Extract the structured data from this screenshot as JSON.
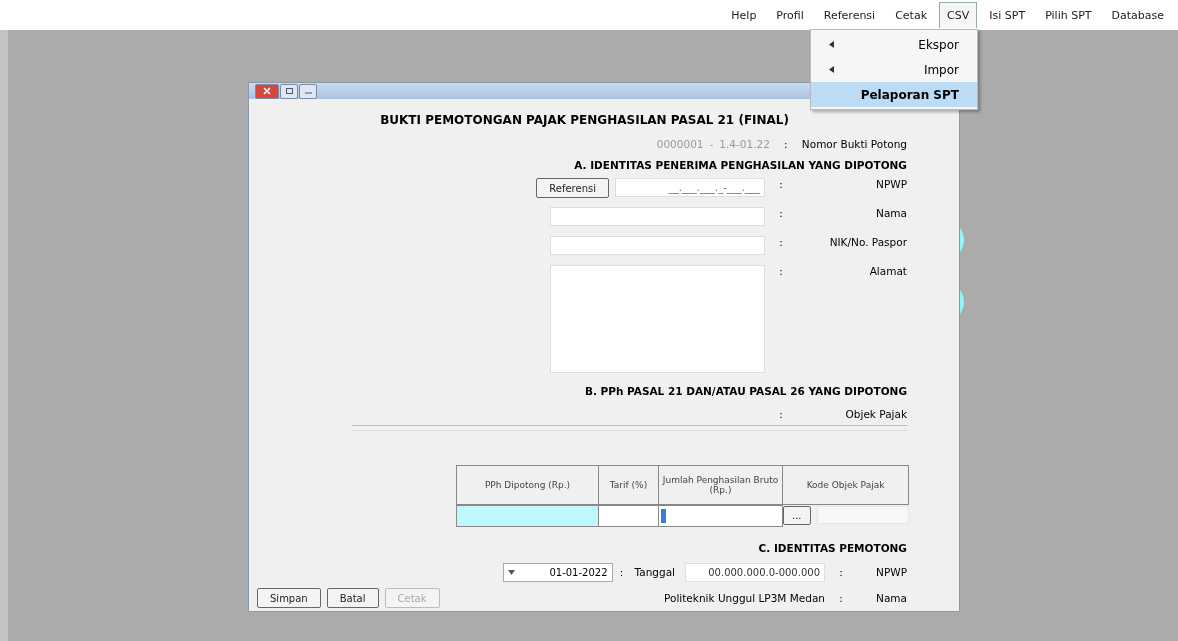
{
  "menu": [
    {
      "label": "Help",
      "selected": false
    },
    {
      "label": "Profil",
      "selected": false
    },
    {
      "label": "Referensi",
      "selected": false
    },
    {
      "label": "Cetak",
      "selected": false
    },
    {
      "label": "CSV",
      "selected": true
    },
    {
      "label": "Isi SPT",
      "selected": false
    },
    {
      "label": "Pilih SPT",
      "selected": false
    },
    {
      "label": "Database",
      "selected": false
    }
  ],
  "dropdown": [
    {
      "label": "Ekspor",
      "submenu": true,
      "selected": false
    },
    {
      "label": "Impor",
      "submenu": true,
      "selected": false
    },
    {
      "label": "Pelaporan SPT",
      "submenu": false,
      "selected": true
    }
  ],
  "form": {
    "title": "BUKTI PEMOTONGAN PAJAK PENGHASILAN PASAL 21 (FINAL)",
    "nomor_bukti": {
      "label": "Nomor Bukti Potong",
      "colon": ":",
      "prefix": "1.4-01.22",
      "separator": "-",
      "number": "0000001"
    },
    "section_a": {
      "heading": "A. IDENTITAS PENERIMA PENGHASILAN YANG DIPOTONG",
      "fields": [
        {
          "label": "NPWP",
          "colon": ":",
          "kind": "masked",
          "value": "__.___.___._-___.___",
          "button": "Referensi"
        },
        {
          "label": "Nama",
          "colon": ":",
          "kind": "text"
        },
        {
          "label": "NIK/No. Paspor",
          "colon": ":",
          "kind": "text"
        },
        {
          "label": "Alamat",
          "colon": ":",
          "kind": "textarea"
        }
      ]
    },
    "section_b": {
      "heading": "B. PPh PASAL 21 DAN/ATAU PASAL 26 YANG DIPOTONG",
      "objek_label": "Objek Pajak",
      "objek_colon": ":",
      "columns": [
        "PPh Dipotong (Rp.)",
        "Tarif (%)",
        "Jumlah Penghasilan Bruto (Rp.)",
        "Kode Objek Pajak"
      ],
      "row": [
        {
          "kind": "highlight"
        },
        {
          "kind": "input",
          "focused": false
        },
        {
          "kind": "input",
          "focused": true
        },
        {
          "kind": "lookup",
          "button": "..."
        }
      ]
    },
    "section_c": {
      "heading": "C. IDENTITAS PEMOTONG",
      "npwp_label": "NPWP",
      "npwp_colon": ":",
      "npwp": "00.000.000.0-000.000",
      "tanggal_label": "Tanggal",
      "tanggal_colon": ":",
      "tanggal": "01-01-2022",
      "nama_label": "Nama",
      "nama_colon": ":",
      "nama": "Politeknik Unggul LP3M Medan"
    }
  },
  "buttons": [
    {
      "label": "Simpan",
      "disabled": false
    },
    {
      "label": "Batal",
      "disabled": false
    },
    {
      "label": "Cetak",
      "disabled": true
    }
  ]
}
